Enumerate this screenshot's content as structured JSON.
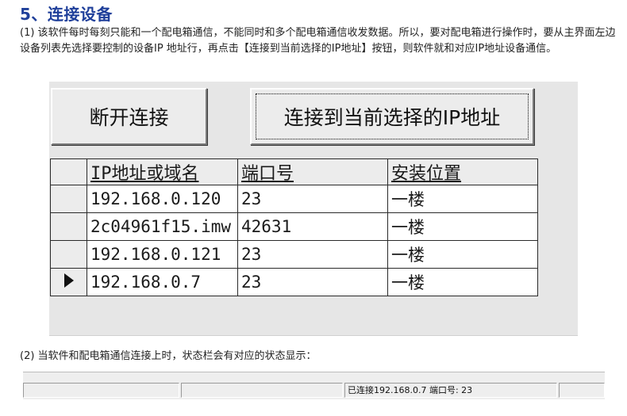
{
  "heading": "5、连接设备",
  "para1": "(1) 该软件每时每刻只能和一个配电箱通信，不能同时和多个配电箱通信收发数据。所以，要对配电箱进行操作时，要从主界面左边设备列表先选择要控制的设备IP 地址行，再点击【连接到当前选择的IP地址】按钮，则软件就和对应IP地址设备通信。",
  "buttons": {
    "disconnect": "断开连接",
    "connect": "连接到当前选择的IP地址"
  },
  "grid": {
    "columns": [
      "IP地址或域名",
      "端口号",
      "安装位置"
    ],
    "rows": [
      {
        "ip": "192.168.0.120",
        "port": "23",
        "location": "一楼",
        "selected": false
      },
      {
        "ip": "2c04961f15.imw",
        "port": "42631",
        "location": "一楼",
        "selected": false
      },
      {
        "ip": "192.168.0.121",
        "port": "23",
        "location": "一楼",
        "selected": false
      },
      {
        "ip": "192.168.0.7",
        "port": "23",
        "location": "一楼",
        "selected": true
      }
    ]
  },
  "para2": "(2) 当软件和配电箱通信连接上时，状态栏会有对应的状态显示：",
  "statusbar": {
    "seg1": "",
    "seg2": "",
    "seg3": "已连接192.168.0.7  端口号: 23",
    "seg4": ""
  }
}
